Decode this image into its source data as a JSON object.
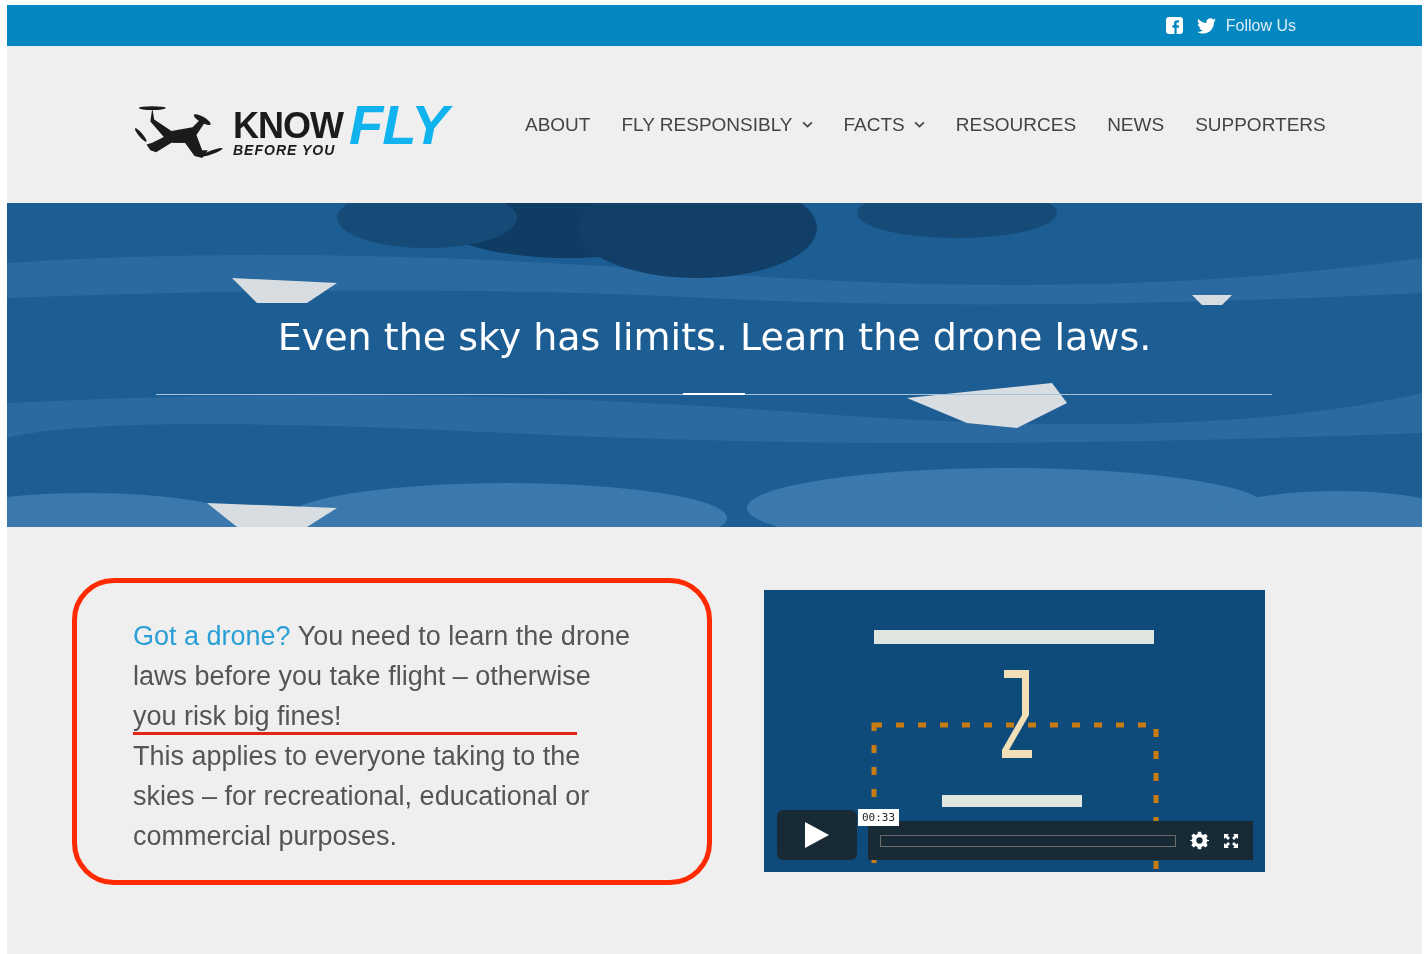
{
  "topbar": {
    "follow_label": "Follow Us"
  },
  "logo": {
    "word_top": "KNOW",
    "word_bottom": "BEFORE YOU",
    "word_accent": "FLY"
  },
  "nav": [
    {
      "label": "ABOUT",
      "has_menu": false
    },
    {
      "label": "FLY RESPONSIBLY",
      "has_menu": true
    },
    {
      "label": "FACTS",
      "has_menu": true
    },
    {
      "label": "RESOURCES",
      "has_menu": false
    },
    {
      "label": "NEWS",
      "has_menu": false
    },
    {
      "label": "SUPPORTERS",
      "has_menu": false
    }
  ],
  "hero": {
    "headline": "Even the sky has limits. Learn the drone laws."
  },
  "intro": {
    "link": "Got a drone?",
    "lead": "You need to learn the drone laws before you take flight – otherwise you risk big fines!",
    "body": "This applies to everyone taking to the skies – for recreational, educational or commercial purposes."
  },
  "video": {
    "kind": "picture",
    "time": "00:33",
    "level": 0
  }
}
